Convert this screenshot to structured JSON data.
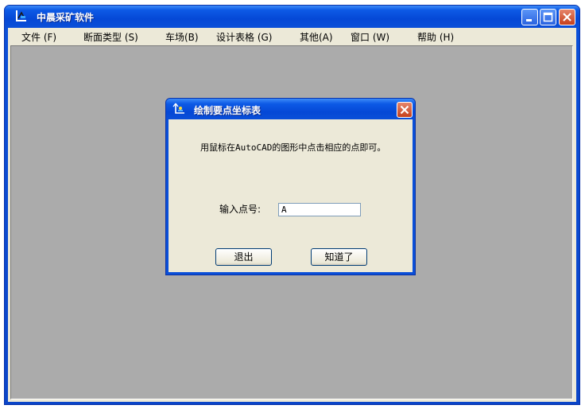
{
  "window": {
    "title": "中晨采矿软件"
  },
  "menu": [
    {
      "label": "文件 (F)"
    },
    {
      "label": "断面类型 (S)"
    },
    {
      "label": "车场(B)"
    },
    {
      "label": "设计表格 (G)"
    },
    {
      "label": "其他(A)"
    },
    {
      "label": "窗口 (W)"
    },
    {
      "label": "帮助 (H)"
    }
  ],
  "dialog": {
    "title": "绘制要点坐标表",
    "message": "用鼠标在AutoCAD的图形中点击相应的点即可。",
    "point_label": "输入点号:",
    "point_value": "A",
    "exit_label": "退出",
    "ok_label": "知道了"
  },
  "icons": {
    "app": "app-logo-icon",
    "minimize": "minimize-icon",
    "maximize": "maximize-icon",
    "close": "close-icon",
    "dialog": "dialog-app-icon"
  },
  "colors": {
    "title_blue": "#0a4fd8",
    "face": "#ece9d8",
    "workspace": "#ababab",
    "close_red": "#c6401c"
  }
}
